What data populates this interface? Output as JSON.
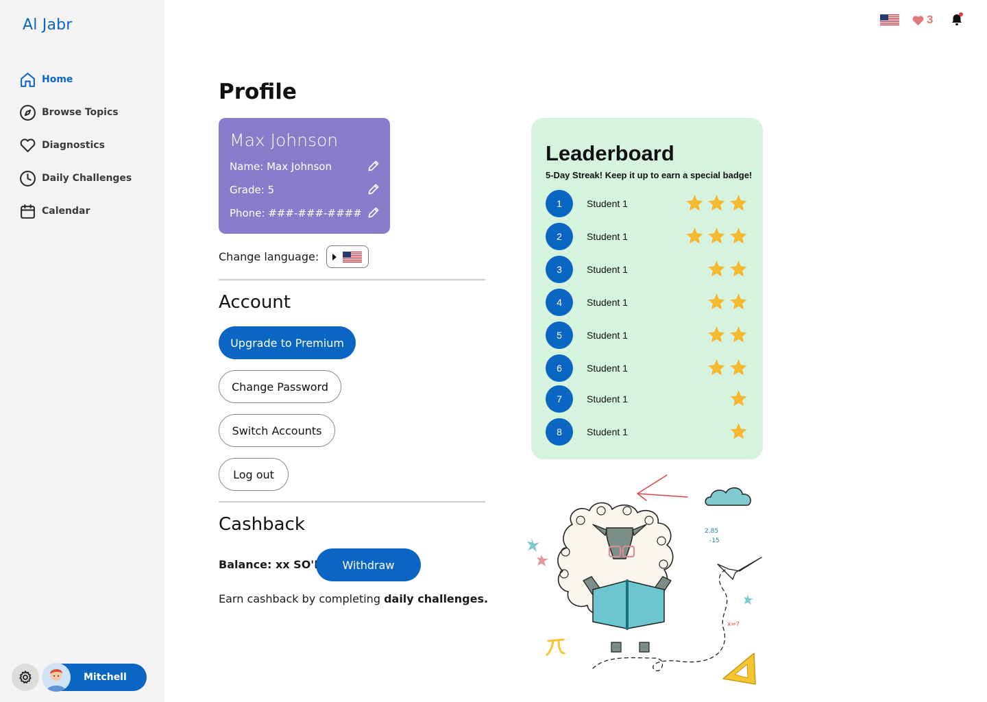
{
  "app": {
    "title": "Al Jabr"
  },
  "sidebar": {
    "items": [
      {
        "label": "Home",
        "icon": "home-icon",
        "active": true
      },
      {
        "label": "Browse Topics",
        "icon": "compass-icon",
        "active": false
      },
      {
        "label": "Diagnostics",
        "icon": "heart-icon",
        "active": false
      },
      {
        "label": "Daily Challenges",
        "icon": "clock-icon",
        "active": false
      },
      {
        "label": "Calendar",
        "icon": "calendar-icon",
        "active": false
      }
    ],
    "user": {
      "name": "Mitchell"
    }
  },
  "topbar": {
    "lives": "3",
    "language_flag": "us-flag-icon"
  },
  "page": {
    "title": "Profile"
  },
  "profile": {
    "display_name": "Max Johnson",
    "name_line": "Name: Max Johnson",
    "grade_line": "Grade: 5",
    "phone_line": "Phone: ###-###-####"
  },
  "language": {
    "label": "Change language:",
    "selected_flag": "us-flag-icon"
  },
  "account": {
    "title": "Account",
    "upgrade": "Upgrade to Premium",
    "change_password": "Change Password",
    "switch_accounts": "Switch Accounts",
    "logout": "Log out"
  },
  "cashback": {
    "title": "Cashback",
    "balance": "Balance: xx SO'M",
    "withdraw": "Withdraw",
    "note_prefix": "Earn cashback by completing ",
    "note_bold": "daily challenges."
  },
  "leaderboard": {
    "title": "Leaderboard",
    "subtitle": "5-Day Streak! Keep it up to earn a special badge!",
    "rows": [
      {
        "rank": "1",
        "name": "Student 1",
        "stars": 3
      },
      {
        "rank": "2",
        "name": "Student 1",
        "stars": 3
      },
      {
        "rank": "3",
        "name": "Student 1",
        "stars": 2
      },
      {
        "rank": "4",
        "name": "Student 1",
        "stars": 2
      },
      {
        "rank": "5",
        "name": "Student 1",
        "stars": 2
      },
      {
        "rank": "6",
        "name": "Student 1",
        "stars": 2
      },
      {
        "rank": "7",
        "name": "Student 1",
        "stars": 1
      },
      {
        "rank": "8",
        "name": "Student 1",
        "stars": 1
      }
    ]
  },
  "colors": {
    "brand": "#0b66c3",
    "card": "#8b7ccb",
    "leaderboard_bg": "#d6f3de",
    "star": "#f7b731",
    "heart": "#e07a7a"
  }
}
